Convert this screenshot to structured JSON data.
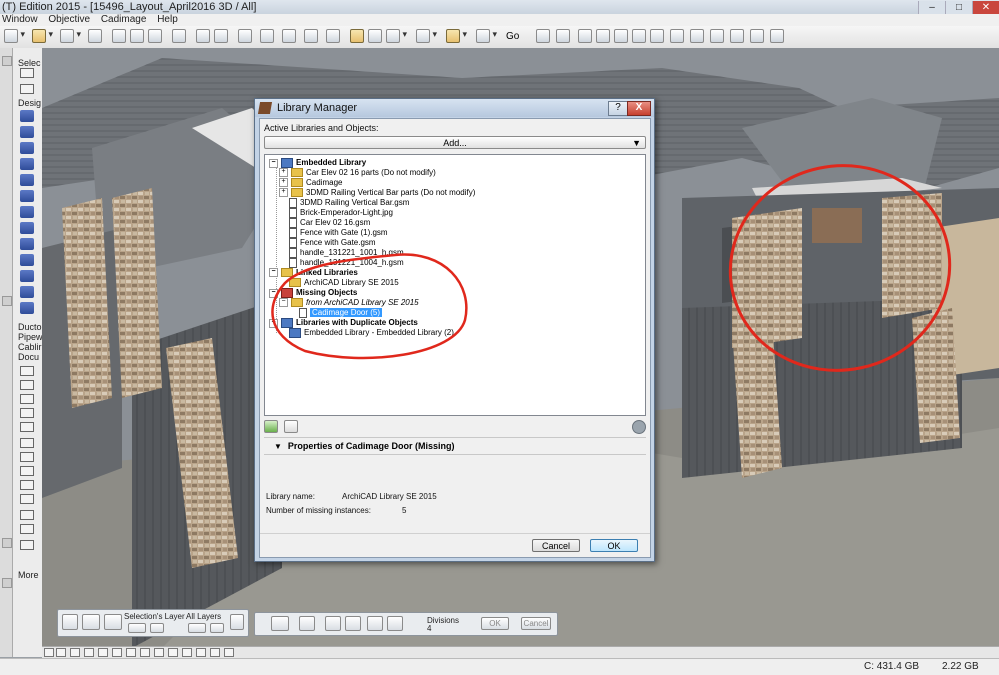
{
  "window": {
    "title": "(T) Edition 2015 - [15496_Layout_April2016 3D / All]"
  },
  "menu": [
    "Window",
    "Objective",
    "Cadimage",
    "Help"
  ],
  "toolbar": {
    "go_label": "Go"
  },
  "toolbox": {
    "labels": [
      "Selec",
      "Desig",
      "Ducto",
      "Pipew",
      "Cablir",
      "Docu",
      "More"
    ]
  },
  "bottom_palette": {
    "selection_layer": "Selection's Layer",
    "all_layers": "All Layers",
    "divisions_label": "Divisions",
    "divisions_value": "4",
    "ok_label": "OK",
    "cancel_label": "Cancel"
  },
  "status": {
    "disk": "C: 431.4 GB",
    "memory": "2.22 GB"
  },
  "dialog": {
    "title": "Library Manager",
    "help_label": "?",
    "close_label": "X",
    "active_label": "Active Libraries and Objects:",
    "add_button": "Add...",
    "tree": {
      "embedded": {
        "label": "Embedded Library",
        "items": [
          "Car Elev 02 16 parts (Do not modify)",
          "Cadimage",
          "3DMD Railing Vertical Bar parts (Do not modify)",
          "3DMD Railing Vertical Bar.gsm",
          "Brick-Emperador-Light.jpg",
          "Car Elev 02 16.gsm",
          "Fence with Gate (1).gsm",
          "Fence with Gate.gsm",
          "handle_131221_1001_h.gsm",
          "handle_131221_1004_h.gsm"
        ]
      },
      "linked": {
        "label": "Linked Libraries",
        "items": [
          "ArchiCAD Library SE 2015"
        ]
      },
      "missing": {
        "label": "Missing Objects",
        "source": "from ArchiCAD Library SE 2015",
        "selected": "Cadimage Door (5)"
      },
      "duplicates": {
        "label": "Libraries with Duplicate Objects",
        "items": [
          "Embedded Library - Embedded Library (2)"
        ]
      }
    },
    "properties": {
      "header": "Properties of Cadimage Door (Missing)",
      "library_name_label": "Library name:",
      "library_name_value": "ArchiCAD Library SE 2015",
      "missing_count_label": "Number of missing instances:",
      "missing_count_value": "5"
    },
    "cancel_button": "Cancel",
    "ok_button": "OK"
  },
  "colors": {
    "annotation": "#e0281c",
    "selection": "#3399ff"
  }
}
